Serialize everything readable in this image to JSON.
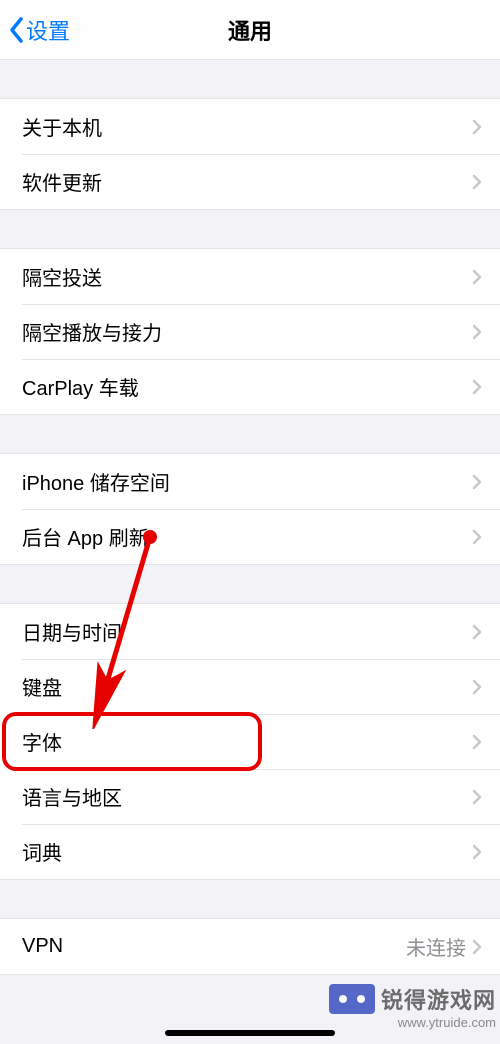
{
  "nav": {
    "back_label": "设置",
    "title": "通用"
  },
  "groups": [
    {
      "items": [
        {
          "key": "about",
          "label": "关于本机"
        },
        {
          "key": "update",
          "label": "软件更新"
        }
      ]
    },
    {
      "items": [
        {
          "key": "airdrop",
          "label": "隔空投送"
        },
        {
          "key": "airplay",
          "label": "隔空播放与接力"
        },
        {
          "key": "carplay",
          "label": "CarPlay 车载"
        }
      ]
    },
    {
      "items": [
        {
          "key": "storage",
          "label": "iPhone 储存空间"
        },
        {
          "key": "bgrefresh",
          "label": "后台 App 刷新"
        }
      ]
    },
    {
      "items": [
        {
          "key": "datetime",
          "label": "日期与时间"
        },
        {
          "key": "keyboard",
          "label": "键盘"
        },
        {
          "key": "fonts",
          "label": "字体"
        },
        {
          "key": "langreg",
          "label": "语言与地区"
        },
        {
          "key": "dict",
          "label": "词典"
        }
      ]
    },
    {
      "items": [
        {
          "key": "vpn",
          "label": "VPN",
          "value": "未连接"
        }
      ]
    }
  ],
  "annotation": {
    "highlighted_key": "fonts",
    "colors": {
      "highlight": "#e60000",
      "arrow": "#e60000"
    }
  },
  "watermark": {
    "brand": "锐得游戏网",
    "url": "www.ytruide.com"
  }
}
